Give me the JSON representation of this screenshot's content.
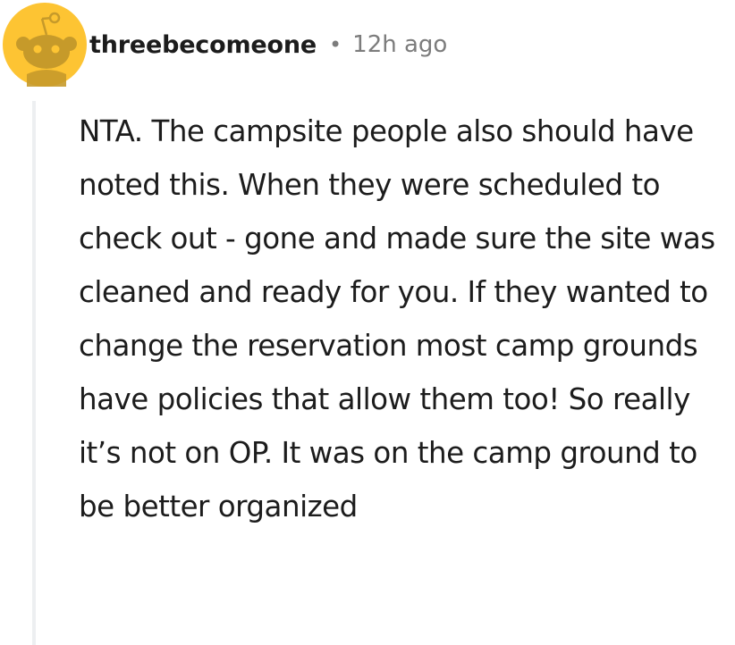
{
  "comment": {
    "username": "threebecomeone",
    "separator": "•",
    "timestamp": "12h ago",
    "avatar_icon": "reddit-snoo-avatar-icon",
    "body": "NTA. The campsite people also should have noted this. When they were scheduled to check out - gone and made sure the site was cleaned and ready for you. If they wanted to change the reservation most camp grounds have policies that allow them too! So really it’s not on OP. It was on the camp ground to be better organized"
  },
  "colors": {
    "avatar_background": "#fdc433",
    "snoo_face": "#c69a2a",
    "text": "#1c1c1c",
    "meta_text": "#7c7c7c",
    "thread_line": "#edeff1"
  }
}
